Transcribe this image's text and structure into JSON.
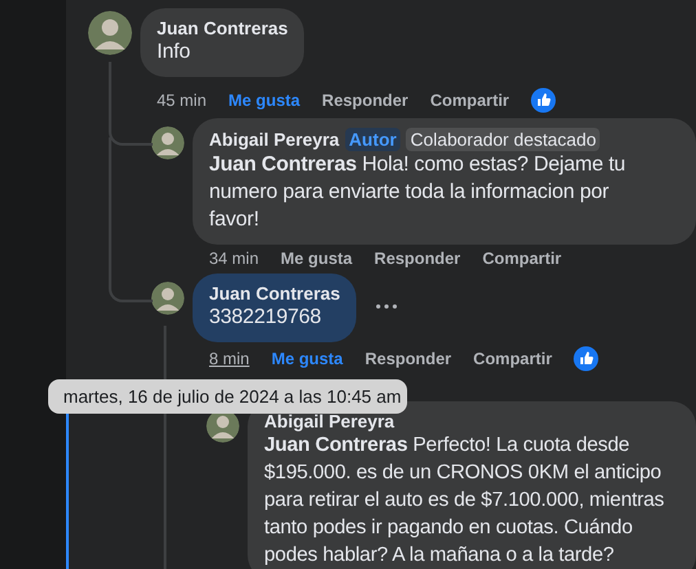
{
  "comments": [
    {
      "author": "Juan Contreras",
      "text": "Info",
      "highlighted": false,
      "more_menu": false,
      "actions": {
        "time": "45 min",
        "time_hovered": false,
        "like": "Me gusta",
        "liked": true,
        "reply": "Responder",
        "share": "Compartir",
        "reaction": true
      },
      "children": [
        {
          "author": "Abigail Pereyra",
          "badges": [
            {
              "label": "Autor",
              "kind": "author"
            },
            {
              "label": "Colaborador destacado",
              "kind": "top"
            }
          ],
          "mention": "Juan Contreras",
          "text": "Hola! como estas? Dejame tu numero para enviarte toda la informacion por favor!",
          "highlighted": false,
          "more_menu": false,
          "actions": {
            "time": "34 min",
            "time_hovered": false,
            "like": "Me gusta",
            "liked": false,
            "reply": "Responder",
            "share": "Compartir",
            "reaction": false
          }
        },
        {
          "author": "Juan Contreras",
          "text": "3382219768",
          "highlighted": true,
          "more_menu": true,
          "actions": {
            "time": "8 min",
            "time_hovered": true,
            "like": "Me gusta",
            "liked": true,
            "reply": "Responder",
            "share": "Compartir",
            "reaction": true
          },
          "children": [
            {
              "author": "Abigail Pereyra",
              "mention": "Juan Contreras",
              "text": "Perfecto! La cuota desde $195.000. es de un CRONOS 0KM el anticipo para retirar el auto es de $7.100.000, mientras tanto podes ir pagando en cuotas. Cuándo podes hablar? A la mañana o a la tarde?",
              "highlighted": false,
              "more_menu": false
            }
          ]
        }
      ]
    }
  ],
  "tooltip": {
    "text": "martes, 16 de julio de 2024 a las 10:45 am"
  }
}
